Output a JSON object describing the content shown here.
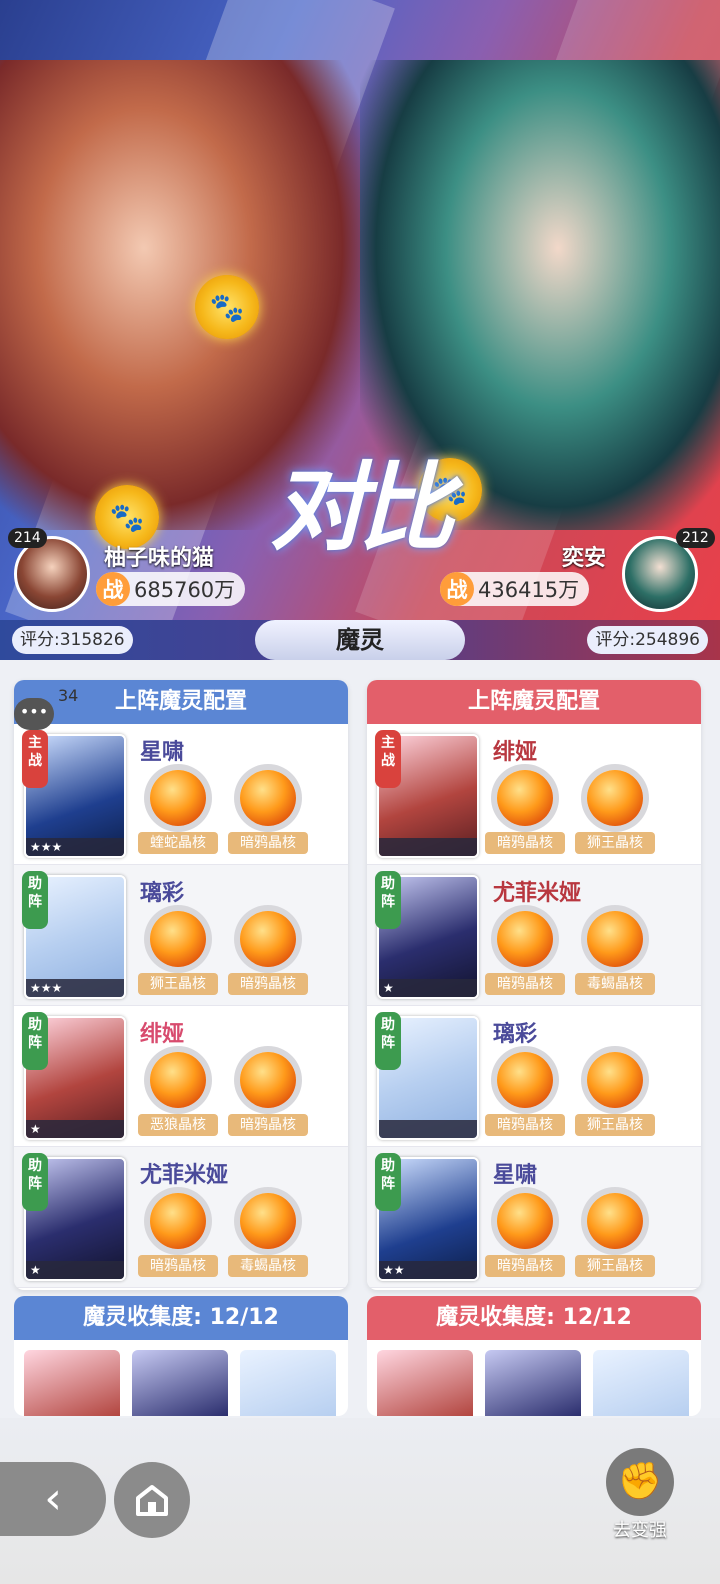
{
  "players": {
    "left": {
      "level": "214",
      "name": "柚子味的猫",
      "power": "685760万",
      "score": "评分:315826"
    },
    "right": {
      "level": "212",
      "name": "奕安",
      "power": "436415万",
      "score": "评分:254896"
    }
  },
  "power_prefix": "战",
  "vs_text": "对比",
  "tab_label": "魔灵",
  "chat": {
    "count": "34"
  },
  "left_panel": {
    "title": "上阵魔灵配置",
    "slots": [
      {
        "role": "主战",
        "name": "星啸",
        "core1": "蝰蛇晶核",
        "core2": "暗鸦晶核",
        "stars": "★★★"
      },
      {
        "role": "助阵",
        "name": "璃彩",
        "core1": "狮王晶核",
        "core2": "暗鸦晶核",
        "stars": "★★★"
      },
      {
        "role": "助阵",
        "name": "绯娅",
        "core1": "恶狼晶核",
        "core2": "暗鸦晶核",
        "stars": "★"
      },
      {
        "role": "助阵",
        "name": "尤菲米娅",
        "core1": "暗鸦晶核",
        "core2": "毒蝎晶核",
        "stars": "★"
      }
    ]
  },
  "right_panel": {
    "title": "上阵魔灵配置",
    "slots": [
      {
        "role": "主战",
        "name": "绯娅",
        "core1": "暗鸦晶核",
        "core2": "狮王晶核",
        "stars": ""
      },
      {
        "role": "助阵",
        "name": "尤菲米娅",
        "core1": "暗鸦晶核",
        "core2": "毒蝎晶核",
        "stars": "★"
      },
      {
        "role": "助阵",
        "name": "璃彩",
        "core1": "暗鸦晶核",
        "core2": "狮王晶核",
        "stars": ""
      },
      {
        "role": "助阵",
        "name": "星啸",
        "core1": "暗鸦晶核",
        "core2": "狮王晶核",
        "stars": "★★"
      }
    ]
  },
  "collection": {
    "left": "魔灵收集度: 12/12",
    "right": "魔灵收集度: 12/12"
  },
  "bottom": {
    "back_icon": "back-arrow-icon",
    "home_icon": "home-icon",
    "strong_label": "去变强",
    "strong_icon": "fist-icon"
  },
  "colors": {
    "blue_accent": "#5b86d4",
    "red_accent": "#e35f6a",
    "core_orange": "#ff9a1a"
  }
}
